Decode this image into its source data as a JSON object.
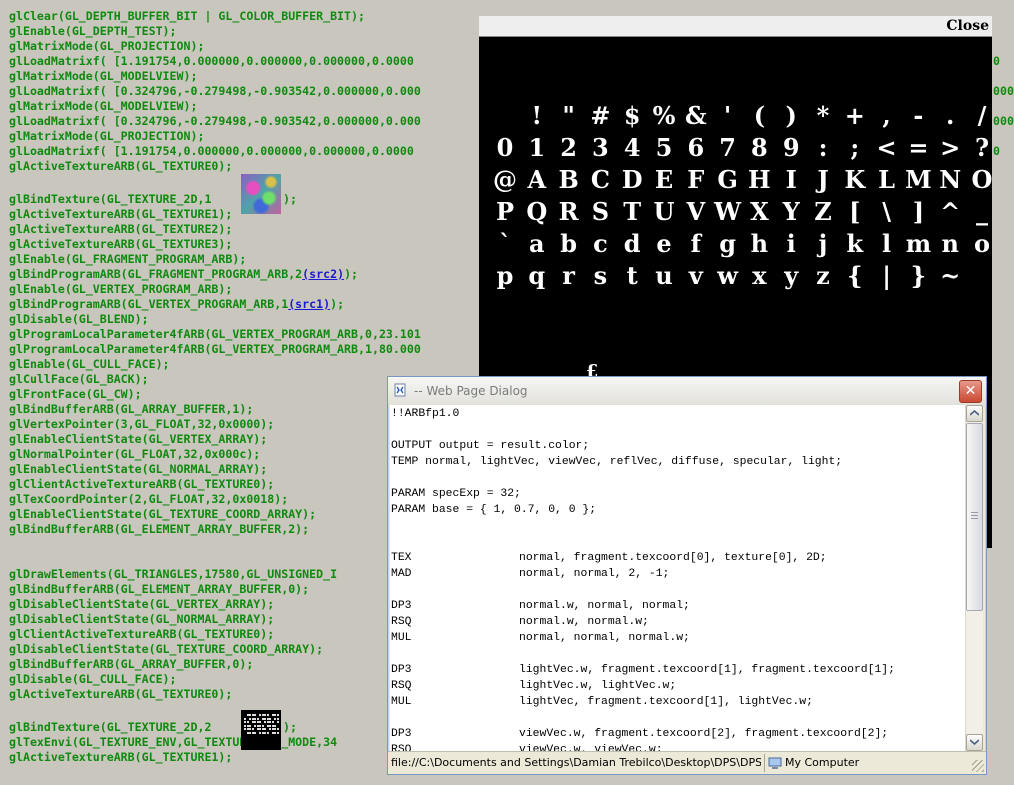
{
  "gl_log": {
    "lines": [
      {
        "text": "glClear(GL_DEPTH_BUFFER_BIT | GL_COLOR_BUFFER_BIT);",
        "link": ""
      },
      {
        "text": "glEnable(GL_DEPTH_TEST);",
        "link": ""
      },
      {
        "text": "glMatrixMode(GL_PROJECTION);",
        "link": ""
      },
      {
        "text": "glLoadMatrixf( [1.191754,0.000000,0.000000,0.000000,0.0000",
        "link": ""
      },
      {
        "text": "glMatrixMode(GL_MODELVIEW);",
        "link": ""
      },
      {
        "text": "glLoadMatrixf( [0.324796,-0.279498,-0.903542,0.000000,0.000",
        "link": ""
      },
      {
        "text": "glMatrixMode(GL_MODELVIEW);",
        "link": ""
      },
      {
        "text": "glLoadMatrixf( [0.324796,-0.279498,-0.903542,0.000000,0.000",
        "link": ""
      },
      {
        "text": "glMatrixMode(GL_PROJECTION);",
        "link": ""
      },
      {
        "text": "glLoadMatrixf( [1.191754,0.000000,0.000000,0.000000,0.0000",
        "link": ""
      },
      {
        "text": "glActiveTextureARB(GL_TEXTURE0);",
        "link": ""
      },
      {
        "text": "",
        "link": ""
      },
      {
        "text": "glBindTexture(GL_TEXTURE_2D,1",
        "link": ""
      },
      {
        "text": "glActiveTextureARB(GL_TEXTURE1);",
        "link": ""
      },
      {
        "text": "glActiveTextureARB(GL_TEXTURE2);",
        "link": ""
      },
      {
        "text": "glActiveTextureARB(GL_TEXTURE3);",
        "link": ""
      },
      {
        "text": "glEnable(GL_FRAGMENT_PROGRAM_ARB);",
        "link": ""
      },
      {
        "text": "glBindProgramARB(GL_FRAGMENT_PROGRAM_ARB,2",
        "link": "(src2)",
        "after": ");"
      },
      {
        "text": "glEnable(GL_VERTEX_PROGRAM_ARB);",
        "link": ""
      },
      {
        "text": "glBindProgramARB(GL_VERTEX_PROGRAM_ARB,1",
        "link": "(src1)",
        "after": ");"
      },
      {
        "text": "glDisable(GL_BLEND);",
        "link": ""
      },
      {
        "text": "glProgramLocalParameter4fARB(GL_VERTEX_PROGRAM_ARB,0,23.101",
        "link": ""
      },
      {
        "text": "glProgramLocalParameter4fARB(GL_VERTEX_PROGRAM_ARB,1,80.000",
        "link": ""
      },
      {
        "text": "glEnable(GL_CULL_FACE);",
        "link": ""
      },
      {
        "text": "glCullFace(GL_BACK);",
        "link": ""
      },
      {
        "text": "glFrontFace(GL_CW);",
        "link": ""
      },
      {
        "text": "glBindBufferARB(GL_ARRAY_BUFFER,1);",
        "link": ""
      },
      {
        "text": "glVertexPointer(3,GL_FLOAT,32,0x0000);",
        "link": ""
      },
      {
        "text": "glEnableClientState(GL_VERTEX_ARRAY);",
        "link": ""
      },
      {
        "text": "glNormalPointer(GL_FLOAT,32,0x000c);",
        "link": ""
      },
      {
        "text": "glEnableClientState(GL_NORMAL_ARRAY);",
        "link": ""
      },
      {
        "text": "glClientActiveTextureARB(GL_TEXTURE0);",
        "link": ""
      },
      {
        "text": "glTexCoordPointer(2,GL_FLOAT,32,0x0018);",
        "link": ""
      },
      {
        "text": "glEnableClientState(GL_TEXTURE_COORD_ARRAY);",
        "link": ""
      },
      {
        "text": "glBindBufferARB(GL_ELEMENT_ARRAY_BUFFER,2);",
        "link": ""
      },
      {
        "text": "",
        "link": ""
      },
      {
        "text": "",
        "link": ""
      },
      {
        "text": "glDrawElements(GL_TRIANGLES,17580,GL_UNSIGNED_I",
        "link": ""
      },
      {
        "text": "glBindBufferARB(GL_ELEMENT_ARRAY_BUFFER,0);",
        "link": ""
      },
      {
        "text": "glDisableClientState(GL_VERTEX_ARRAY);",
        "link": ""
      },
      {
        "text": "glDisableClientState(GL_NORMAL_ARRAY);",
        "link": ""
      },
      {
        "text": "glClientActiveTextureARB(GL_TEXTURE0);",
        "link": ""
      },
      {
        "text": "glDisableClientState(GL_TEXTURE_COORD_ARRAY);",
        "link": ""
      },
      {
        "text": "glBindBufferARB(GL_ARRAY_BUFFER,0);",
        "link": ""
      },
      {
        "text": "glDisable(GL_CULL_FACE);",
        "link": ""
      },
      {
        "text": "glActiveTextureARB(GL_TEXTURE0);",
        "link": ""
      },
      {
        "text": "",
        "link": ""
      },
      {
        "text": "glBindTexture(GL_TEXTURE_2D,2",
        "link": ""
      },
      {
        "text": "glTexEnvi(GL_TEXTURE_ENV,GL_TEXTURE_ENV_MODE,34",
        "link": ""
      },
      {
        "text": "glActiveTextureARB(GL_TEXTURE1);",
        "link": ""
      }
    ],
    "bind_texture_1_tail": ");",
    "bind_texture_2_tail": ");",
    "right_tails": [
      "0",
      "000",
      "000",
      "0"
    ]
  },
  "font_window": {
    "close_label": "Close",
    "glyph_rows": [
      [
        "!",
        "\"",
        "#",
        "$",
        "%",
        "&",
        "'",
        "(",
        ")",
        "*",
        "+",
        ",",
        "-",
        ".",
        "/"
      ],
      [
        "0",
        "1",
        "2",
        "3",
        "4",
        "5",
        "6",
        "7",
        "8",
        "9",
        ":",
        ";",
        "<",
        "=",
        ">",
        "?"
      ],
      [
        "@",
        "A",
        "B",
        "C",
        "D",
        "E",
        "F",
        "G",
        "H",
        "I",
        "J",
        "K",
        "L",
        "M",
        "N",
        "O"
      ],
      [
        "P",
        "Q",
        "R",
        "S",
        "T",
        "U",
        "V",
        "W",
        "X",
        "Y",
        "Z",
        "[",
        "\\",
        "]",
        "^",
        "_"
      ],
      [
        "`",
        "a",
        "b",
        "c",
        "d",
        "e",
        "f",
        "g",
        "h",
        "i",
        "j",
        "k",
        "l",
        "m",
        "n",
        "o"
      ],
      [
        "p",
        "q",
        "r",
        "s",
        "t",
        "u",
        "v",
        "w",
        "x",
        "y",
        "z",
        "{",
        "|",
        "}",
        "~"
      ]
    ],
    "partial_glyph": "£"
  },
  "dialog": {
    "title": "-- Web Page Dialog",
    "close_glyph": "✕",
    "source": [
      {
        "op": "!!ARBfp1.0",
        "args": ""
      },
      {
        "op": "",
        "args": ""
      },
      {
        "op": "OUTPUT output = result.color;",
        "args": ""
      },
      {
        "op": "TEMP normal, lightVec, viewVec, reflVec, diffuse, specular, light;",
        "args": ""
      },
      {
        "op": "",
        "args": ""
      },
      {
        "op": "PARAM specExp = 32;",
        "args": ""
      },
      {
        "op": "PARAM base = { 1, 0.7, 0, 0 };",
        "args": ""
      },
      {
        "op": "",
        "args": ""
      },
      {
        "op": "",
        "args": ""
      },
      {
        "op": "TEX",
        "args": "normal, fragment.texcoord[0], texture[0], 2D;"
      },
      {
        "op": "MAD",
        "args": "normal, normal, 2, -1;"
      },
      {
        "op": "",
        "args": ""
      },
      {
        "op": "DP3",
        "args": "normal.w, normal, normal;"
      },
      {
        "op": "RSQ",
        "args": "normal.w, normal.w;"
      },
      {
        "op": "MUL",
        "args": "normal, normal, normal.w;"
      },
      {
        "op": "",
        "args": ""
      },
      {
        "op": "DP3",
        "args": "lightVec.w, fragment.texcoord[1], fragment.texcoord[1];"
      },
      {
        "op": "RSQ",
        "args": "lightVec.w, lightVec.w;"
      },
      {
        "op": "MUL",
        "args": "lightVec, fragment.texcoord[1], lightVec.w;"
      },
      {
        "op": "",
        "args": ""
      },
      {
        "op": "DP3",
        "args": "viewVec.w, fragment.texcoord[2], fragment.texcoord[2];"
      },
      {
        "op": "RSQ",
        "args": "viewVec.w, viewVec.w;"
      }
    ],
    "status_url": "file://C:\\Documents and Settings\\Damian Trebilco\\Desktop\\DPS\\DPS\\Frame_0",
    "status_zone": "My Computer"
  },
  "colors": {
    "background": "#c9c6be",
    "gl_text": "#0f8a0f",
    "link": "#1a1ad0",
    "preview_bg": "#000000",
    "dialog_close": "#c94a33"
  }
}
